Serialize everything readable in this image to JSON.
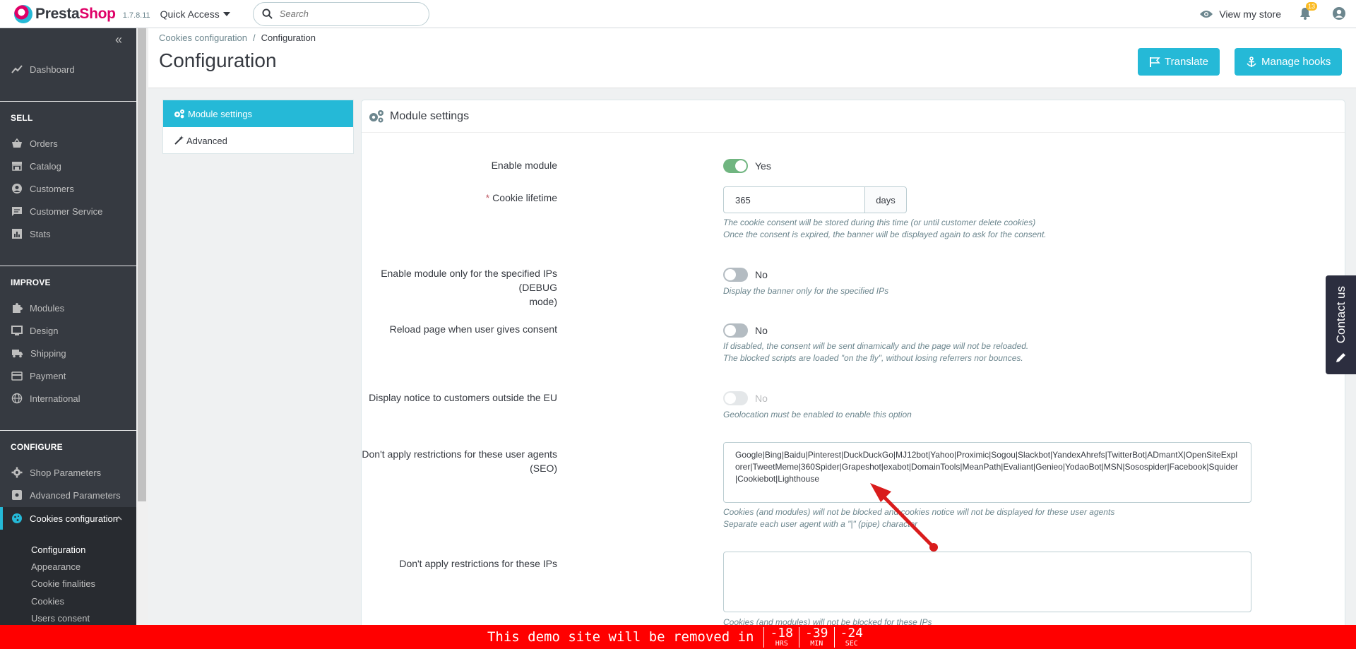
{
  "header": {
    "logo_part1": "Presta",
    "logo_part2": "Shop",
    "version": "1.7.8.11",
    "quick_access": "Quick Access",
    "search_placeholder": "Search",
    "view_store": "View my store",
    "notifications": "13"
  },
  "sidebar": {
    "dashboard": "Dashboard",
    "sell": "SELL",
    "orders": "Orders",
    "catalog": "Catalog",
    "customers": "Customers",
    "customer_service": "Customer Service",
    "stats": "Stats",
    "improve": "IMPROVE",
    "modules": "Modules",
    "design": "Design",
    "shipping": "Shipping",
    "payment": "Payment",
    "international": "International",
    "configure": "CONFIGURE",
    "shop_parameters": "Shop Parameters",
    "advanced_parameters": "Advanced Parameters",
    "cookies_configuration": "Cookies configuration",
    "sub": {
      "configuration": "Configuration",
      "appearance": "Appearance",
      "cookie_finalities": "Cookie finalities",
      "cookies": "Cookies",
      "users_consent": "Users consent"
    }
  },
  "toolbar": {
    "breadcrumb_parent": "Cookies configuration",
    "breadcrumb_sep": "/",
    "breadcrumb_current": "Configuration",
    "title": "Configuration",
    "translate": "Translate",
    "manage_hooks": "Manage hooks"
  },
  "tabs": {
    "module_settings": "Module settings",
    "advanced": "Advanced"
  },
  "panel": {
    "heading": "Module settings",
    "enable_module": {
      "label": "Enable module",
      "value": "Yes"
    },
    "cookie_lifetime": {
      "label": "Cookie lifetime",
      "required": "*",
      "value": "365",
      "unit": "days",
      "help1": "The cookie consent will be stored during this time (or until customer delete cookies)",
      "help2": "Once the consent is expired, the banner will be displayed again to ask for the consent."
    },
    "debug_ips": {
      "label1": "Enable module only for the specified IPs (DEBUG",
      "label2": "mode)",
      "value": "No",
      "help": "Display the banner only for the specified IPs"
    },
    "reload_page": {
      "label": "Reload page when user gives consent",
      "value": "No",
      "help1": "If disabled, the consent will be sent dinamically and the page will not be reloaded.",
      "help2": "The blocked scripts are loaded \"on the fly\", without losing referrers nor bounces."
    },
    "outside_eu": {
      "label": "Display notice to customers outside the EU",
      "value": "No",
      "help": "Geolocation must be enabled to enable this option"
    },
    "user_agents": {
      "label": "Don't apply restrictions for these user agents (SEO)",
      "value": "Google|Bing|Baidu|Pinterest|DuckDuckGo|MJ12bot|Yahoo|Proximic|Sogou|Slackbot|YandexAhrefs|TwitterBot|ADmantX|OpenSiteExplorer|TweetMeme|360Spider|Grapeshot|exabot|DomainTools|MeanPath|Evaliant|Genieo|YodaoBot|MSN|Sosospider|Facebook|Squider|Cookiebot|Lighthouse",
      "help1": "Cookies (and modules) will not be blocked and cookies notice will not be displayed for these user agents",
      "help2": "Separate each user agent with a \"|\" (pipe) character"
    },
    "ips": {
      "label": "Don't apply restrictions for these IPs",
      "value": "",
      "help": "Cookies (and modules) will not be blocked for these IPs"
    }
  },
  "contact": "Contact us",
  "demo": {
    "text": "This demo site will be removed in",
    "hrs": "-18",
    "hrs_unit": "HRS",
    "min": "-39",
    "min_unit": "MIN",
    "sec": "-24",
    "sec_unit": "SEC"
  },
  "colors": {
    "accent": "#25b9d7",
    "sidebar": "#363a41",
    "toggle_on": "#70b580",
    "banner": "#ff0000",
    "arrow": "#e02020"
  }
}
